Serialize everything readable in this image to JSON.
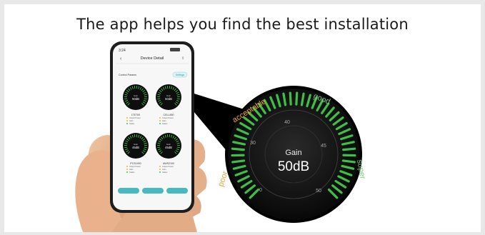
{
  "headline": "The app helps you find the best installation",
  "phone": {
    "status_time": "3:24",
    "title": "Device Detail",
    "section_label": "Control Params",
    "settings_button": "Settings",
    "dials": [
      {
        "label": "Gain",
        "value": "50dB",
        "name": "LTE700",
        "lines": [
          "Output Power",
          "Gain",
          "Status"
        ]
      },
      {
        "label": "Gain",
        "value": "50dB",
        "name": "CELL850",
        "lines": [
          "Output Power",
          "Gain",
          "Status"
        ]
      },
      {
        "label": "Gain",
        "value": "45dB",
        "name": "PCS1900",
        "lines": [
          "Output Power",
          "Gain",
          "Status"
        ]
      },
      {
        "label": "Gain",
        "value": "45dB",
        "name": "AWS2100",
        "lines": [
          "Output Power",
          "Gain",
          "Status"
        ]
      }
    ],
    "bottom_buttons": [
      "",
      "",
      ""
    ]
  },
  "gauge": {
    "label": "Gain",
    "value": "50dB",
    "ticks": {
      "t0": "0",
      "t30": "30",
      "t40": "40",
      "t45": "45",
      "t50": "50"
    },
    "zones": {
      "poor": "poor",
      "acceptable": "acceptable",
      "good": "good",
      "super": "super"
    },
    "colors": {
      "poor": "#e8a33a",
      "good": "#7cc576",
      "tick_green": "#3fbf4a",
      "face": "#111111"
    }
  }
}
